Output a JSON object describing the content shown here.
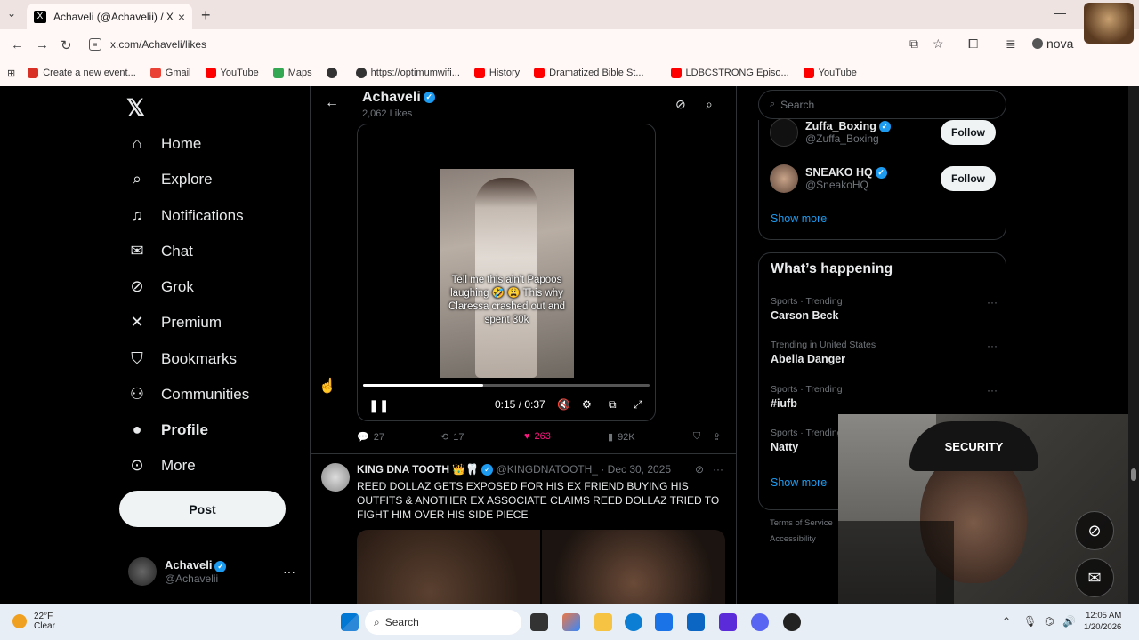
{
  "browser": {
    "tab_title": "Achaveli (@Achavelii) / X",
    "url": "x.com/Achaveli/likes",
    "profile_name": "nova",
    "bookmarks": [
      {
        "label": "Create a new event...",
        "color": "#d93025"
      },
      {
        "label": "Gmail",
        "color": "#ea4335"
      },
      {
        "label": "YouTube",
        "color": "#ff0000"
      },
      {
        "label": "Maps",
        "color": "#34a853"
      },
      {
        "label": "",
        "color": "#333333"
      },
      {
        "label": "https://optimumwifi...",
        "color": "#333333"
      },
      {
        "label": "History",
        "color": "#ff0000"
      },
      {
        "label": "Dramatized Bible St...",
        "color": "#ff0000"
      },
      {
        "label": "LDBCSTRONG Episo...",
        "color": "#ff0000"
      },
      {
        "label": "YouTube",
        "color": "#ff0000"
      }
    ]
  },
  "nav": {
    "items": [
      {
        "label": "Home",
        "icon": "home-icon",
        "glyph": "⌂"
      },
      {
        "label": "Explore",
        "icon": "search-icon",
        "glyph": "⌕"
      },
      {
        "label": "Notifications",
        "icon": "bell-icon",
        "glyph": "🔔"
      },
      {
        "label": "Chat",
        "icon": "mail-icon",
        "glyph": "✉"
      },
      {
        "label": "Grok",
        "icon": "grok-icon",
        "glyph": "⊘"
      },
      {
        "label": "Premium",
        "icon": "x-icon",
        "glyph": "𝕏"
      },
      {
        "label": "Bookmarks",
        "icon": "bookmark-icon",
        "glyph": "⛉"
      },
      {
        "label": "Communities",
        "icon": "people-icon",
        "glyph": "👥"
      },
      {
        "label": "Profile",
        "icon": "person-icon",
        "glyph": "👤"
      },
      {
        "label": "More",
        "icon": "more-icon",
        "glyph": "⋯"
      }
    ],
    "post_label": "Post",
    "account": {
      "name": "Achaveli",
      "handle": "@Achavelii"
    }
  },
  "header": {
    "title": "Achaveli",
    "subtitle": "2,062 Likes"
  },
  "video": {
    "caption": "Tell me this ain't Papoos laughing 🤣 😩 This why Claressa crashed out and spent 30k",
    "time": "0:15 / 0:37",
    "progress": 0.42
  },
  "actions": {
    "replies": "27",
    "reposts": "17",
    "likes": "263",
    "views": "92K"
  },
  "tweet2": {
    "name": "KING DNA TOOTH 👑🦷",
    "handle": "@KINGDNATOOTH_",
    "date": "· Dec 30, 2025",
    "text": "REED DOLLAZ GETS EXPOSED FOR HIS EX FRIEND BUYING HIS OUTFITS & ANOTHER EX ASSOCIATE CLAIMS REED DOLLAZ TRIED TO FIGHT HIM OVER HIS SIDE PIECE"
  },
  "right": {
    "search_placeholder": "Search",
    "who_to_follow": [
      {
        "name": "Zuffa_Boxing",
        "handle": "@Zuffa_Boxing",
        "button": "Follow"
      },
      {
        "name": "SNEAKO HQ",
        "handle": "@SneakoHQ",
        "button": "Follow"
      }
    ],
    "show_more": "Show more",
    "happening_title": "What’s happening",
    "trends": [
      {
        "context": "Sports · Trending",
        "title": "Carson Beck"
      },
      {
        "context": "Trending in United States",
        "title": "Abella Danger"
      },
      {
        "context": "Sports · Trending",
        "title": "#iufb"
      },
      {
        "context": "Sports · Trending",
        "title": "Natty"
      }
    ],
    "show_more_2": "Show more",
    "footer_1": "Terms of Service",
    "footer_2": "Accessibility"
  },
  "webcam": {
    "cap_text": "SECURITY"
  },
  "taskbar": {
    "temp": "22°F",
    "condition": "Clear",
    "search": "Search",
    "time": "12:05 AM",
    "date": "1/20/2026"
  }
}
